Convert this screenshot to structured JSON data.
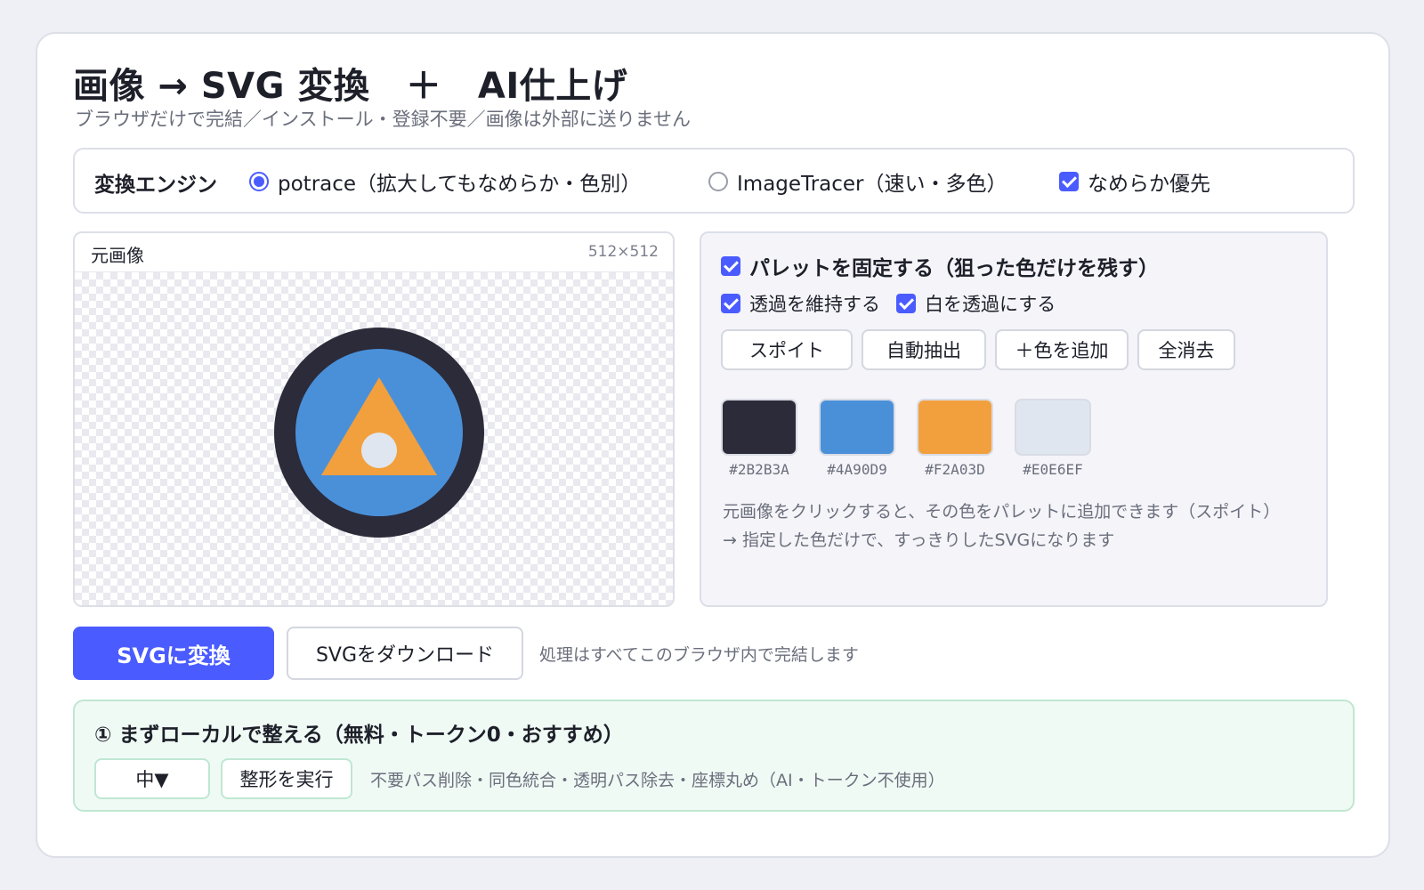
{
  "header": {
    "title": "画像 → SVG 変換　＋　AI仕上げ",
    "subtitle": "ブラウザだけで完結／インストール・登録不要／画像は外部に送りません"
  },
  "engine": {
    "label": "変換エンジン",
    "options": [
      {
        "label": "potrace（拡大してもなめらか・色別）",
        "selected": true
      },
      {
        "label": "ImageTracer（速い・多色）",
        "selected": false
      }
    ],
    "smooth_label": "なめらか優先",
    "smooth_checked": true
  },
  "source": {
    "label": "元画像",
    "size": "512×512",
    "image_colors": {
      "ring": "#2B2B3A",
      "disc": "#4A90D9",
      "triangle": "#F2A03D",
      "dot": "#E0E6EF"
    }
  },
  "palette": {
    "fix_label": "パレットを固定する（狙った色だけを残す）",
    "fix_checked": true,
    "transparency_label": "透過を維持する",
    "transparency_checked": true,
    "white_label": "白を透過にする",
    "white_checked": true,
    "buttons": [
      "スポイト",
      "自動抽出",
      "＋色を追加",
      "全消去"
    ],
    "swatches": [
      {
        "color": "#2B2B3A",
        "code": "#2B2B3A"
      },
      {
        "color": "#4A90D9",
        "code": "#4A90D9"
      },
      {
        "color": "#F2A03D",
        "code": "#F2A03D"
      },
      {
        "color": "#E0E6EF",
        "code": "#E0E6EF"
      }
    ],
    "hint_line1": "元画像をクリックすると、その色をパレットに追加できます（スポイト）",
    "hint_line2": "→ 指定した色だけで、すっきりしたSVGになります"
  },
  "actions": {
    "convert_label": "SVGに変換",
    "download_label": "SVGをダウンロード",
    "note": "処理はすべてこのブラウザ内で完結します"
  },
  "local": {
    "title": "① まずローカルで整える（無料・トークン0・おすすめ）",
    "level_value": "中▼",
    "run_label": "整形を実行",
    "description": "不要パス削除・同色統合・透明パス除去・座標丸め（AI・トークン不使用）"
  },
  "colors": {
    "accent": "#4A5CFF"
  }
}
